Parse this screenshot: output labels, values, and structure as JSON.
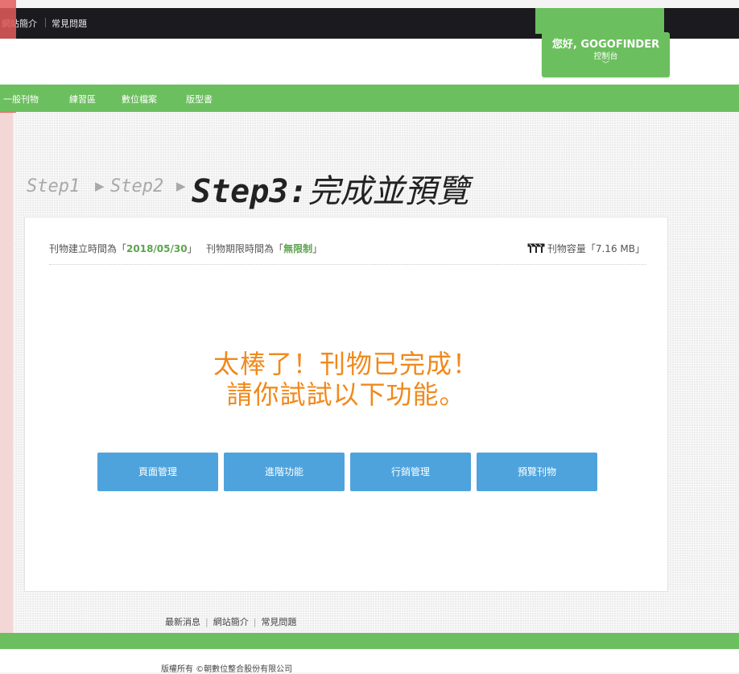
{
  "topbar": {
    "links": [
      "網站簡介",
      "常見問題"
    ]
  },
  "user": {
    "greeting": "您好, GOGOFINDER",
    "console": "控制台",
    "chevron": "﹀"
  },
  "nav": {
    "items": [
      "一般刊物",
      "練習區",
      "數位檔案",
      "版型書"
    ]
  },
  "steps": {
    "step1": "Step1",
    "step2": "Step2",
    "arrow": "▶",
    "current_en": "Step3:",
    "current_zh": "完成並預覽"
  },
  "info": {
    "created_prefix": "刊物建立時間為「",
    "created_date": "2018/05/30",
    "created_suffix": "」",
    "limit_prefix": "刊物期限時間為「",
    "limit_value": "無限制",
    "limit_suffix": "」",
    "capacity_prefix": "刊物容量「",
    "capacity_value": "7.16 MB",
    "capacity_suffix": "」"
  },
  "message": {
    "line1": "太棒了！刊物已完成！",
    "line2": "請你試試以下功能。"
  },
  "buttons": [
    "頁面管理",
    "進階功能",
    "行銷管理",
    "預覽刊物"
  ],
  "footer": {
    "links": [
      "最新消息",
      "網站簡介",
      "常見問題"
    ],
    "separator": "|",
    "copyright": "版權所有 ©朝數位整合股份有限公司"
  },
  "colors": {
    "green": "#6cbf5e",
    "orange": "#f0891c",
    "button_blue": "#4ea3dd",
    "topbar": "#1b1b1f"
  }
}
